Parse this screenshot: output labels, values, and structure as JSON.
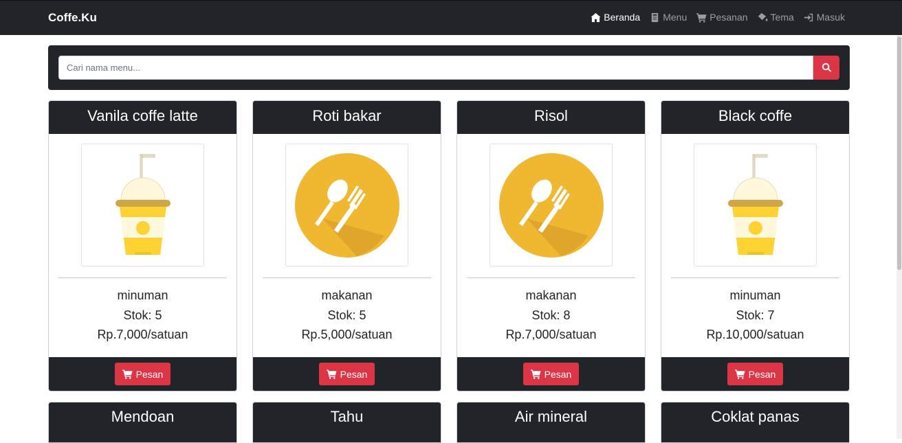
{
  "brand": "Coffe.Ku",
  "nav": [
    {
      "label": "Beranda",
      "icon": "home-icon",
      "active": true
    },
    {
      "label": "Menu",
      "icon": "book-icon",
      "active": false
    },
    {
      "label": "Pesanan",
      "icon": "cart-icon",
      "active": false
    },
    {
      "label": "Tema",
      "icon": "paint-bucket-icon",
      "active": false
    },
    {
      "label": "Masuk",
      "icon": "sign-in-icon",
      "active": false
    }
  ],
  "search": {
    "placeholder": "Cari nama menu..."
  },
  "order_label": "Pesan",
  "colors": {
    "dark": "#212529",
    "accent": "#dc3545",
    "mustard": "#f0b731"
  },
  "menu_items": [
    {
      "name": "Vanila coffe latte",
      "category": "minuman",
      "stock": "Stok: 5",
      "price": "Rp.7,000/satuan",
      "image": "drink-cup-icon"
    },
    {
      "name": "Roti bakar",
      "category": "makanan",
      "stock": "Stok: 5",
      "price": "Rp.5,000/satuan",
      "image": "spoon-fork-icon"
    },
    {
      "name": "Risol",
      "category": "makanan",
      "stock": "Stok: 8",
      "price": "Rp.7,000/satuan",
      "image": "spoon-fork-icon"
    },
    {
      "name": "Black coffe",
      "category": "minuman",
      "stock": "Stok: 7",
      "price": "Rp.10,000/satuan",
      "image": "drink-cup-icon"
    },
    {
      "name": "Mendoan"
    },
    {
      "name": "Tahu"
    },
    {
      "name": "Air mineral"
    },
    {
      "name": "Coklat panas"
    }
  ]
}
